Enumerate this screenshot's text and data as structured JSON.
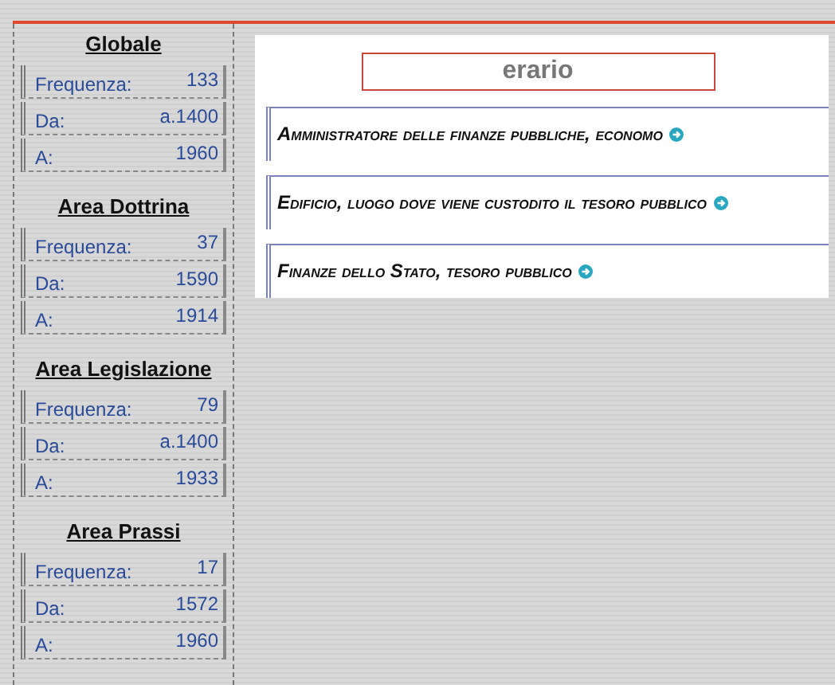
{
  "sidebar": {
    "sections": [
      {
        "title": "Globale",
        "rows": [
          {
            "label": "Frequenza:",
            "value": "133"
          },
          {
            "label": "Da:",
            "value": "a.1400"
          },
          {
            "label": "A:",
            "value": "1960"
          }
        ]
      },
      {
        "title": "Area Dottrina",
        "rows": [
          {
            "label": "Frequenza:",
            "value": "37"
          },
          {
            "label": "Da:",
            "value": "1590"
          },
          {
            "label": "A:",
            "value": "1914"
          }
        ]
      },
      {
        "title": "Area Legislazione",
        "rows": [
          {
            "label": "Frequenza:",
            "value": "79"
          },
          {
            "label": "Da:",
            "value": "a.1400"
          },
          {
            "label": "A:",
            "value": "1933"
          }
        ]
      },
      {
        "title": "Area Prassi",
        "rows": [
          {
            "label": "Frequenza:",
            "value": "17"
          },
          {
            "label": "Da:",
            "value": "1572"
          },
          {
            "label": "A:",
            "value": "1960"
          }
        ]
      }
    ]
  },
  "main": {
    "term": "erario",
    "definitions": [
      {
        "text": "Amministratore delle finanze pubbliche, economo"
      },
      {
        "text": "Edificio, luogo dove viene custodito il tesoro pubblico"
      },
      {
        "text": "Finanze dello Stato, tesoro pubblico"
      }
    ]
  }
}
